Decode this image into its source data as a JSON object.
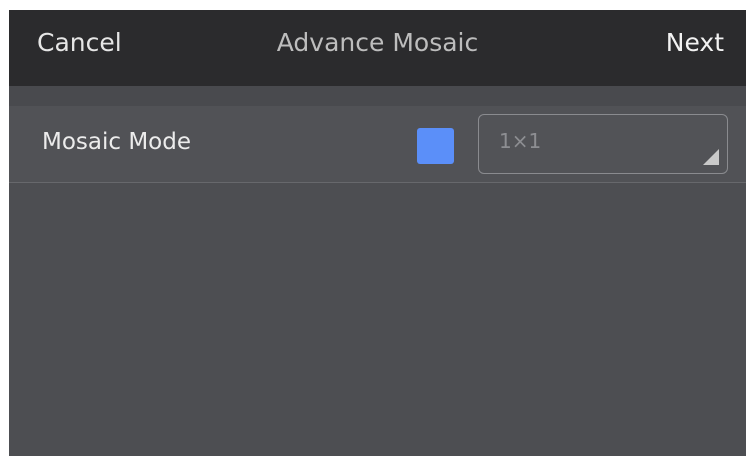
{
  "header": {
    "cancel_label": "Cancel",
    "title": "Advance Mosaic",
    "next_label": "Next"
  },
  "settings": {
    "mosaic_mode": {
      "label": "Mosaic Mode",
      "swatch_color": "#5b8ff9",
      "selected_value": "1×1"
    }
  }
}
